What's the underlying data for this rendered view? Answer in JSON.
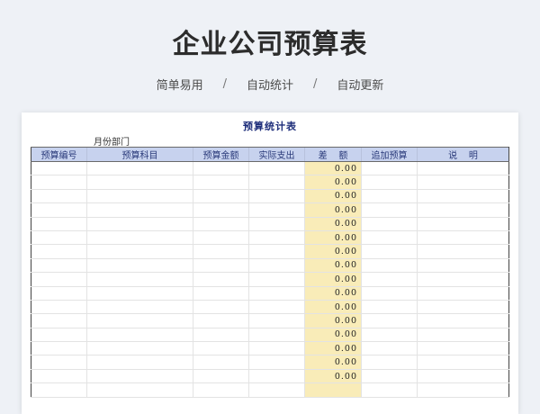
{
  "header": {
    "title": "企业公司预算表",
    "taglines": [
      "简单易用",
      "自动统计",
      "自动更新"
    ],
    "separator": "/"
  },
  "sheet": {
    "title": "预算统计表",
    "subtitle": "月份部门",
    "columns": [
      "预算编号",
      "预算科目",
      "预算金额",
      "实际支出",
      "差    额",
      "追加预算",
      "说    明"
    ],
    "rows": [
      [
        "",
        "",
        "",
        "",
        "0.00",
        "",
        ""
      ],
      [
        "",
        "",
        "",
        "",
        "0.00",
        "",
        ""
      ],
      [
        "",
        "",
        "",
        "",
        "0.00",
        "",
        ""
      ],
      [
        "",
        "",
        "",
        "",
        "0.00",
        "",
        ""
      ],
      [
        "",
        "",
        "",
        "",
        "0.00",
        "",
        ""
      ],
      [
        "",
        "",
        "",
        "",
        "0.00",
        "",
        ""
      ],
      [
        "",
        "",
        "",
        "",
        "0.00",
        "",
        ""
      ],
      [
        "",
        "",
        "",
        "",
        "0.00",
        "",
        ""
      ],
      [
        "",
        "",
        "",
        "",
        "0.00",
        "",
        ""
      ],
      [
        "",
        "",
        "",
        "",
        "0.00",
        "",
        ""
      ],
      [
        "",
        "",
        "",
        "",
        "0.00",
        "",
        ""
      ],
      [
        "",
        "",
        "",
        "",
        "0.00",
        "",
        ""
      ],
      [
        "",
        "",
        "",
        "",
        "0.00",
        "",
        ""
      ],
      [
        "",
        "",
        "",
        "",
        "0.00",
        "",
        ""
      ],
      [
        "",
        "",
        "",
        "",
        "0.00",
        "",
        ""
      ],
      [
        "",
        "",
        "",
        "",
        "0.00",
        "",
        ""
      ],
      [
        "",
        "",
        "",
        "",
        "",
        "",
        ""
      ]
    ]
  },
  "colors": {
    "header_fill": "#c7d2ee",
    "diff_fill": "#f9ecb8",
    "title_text": "#1d2d7a"
  }
}
